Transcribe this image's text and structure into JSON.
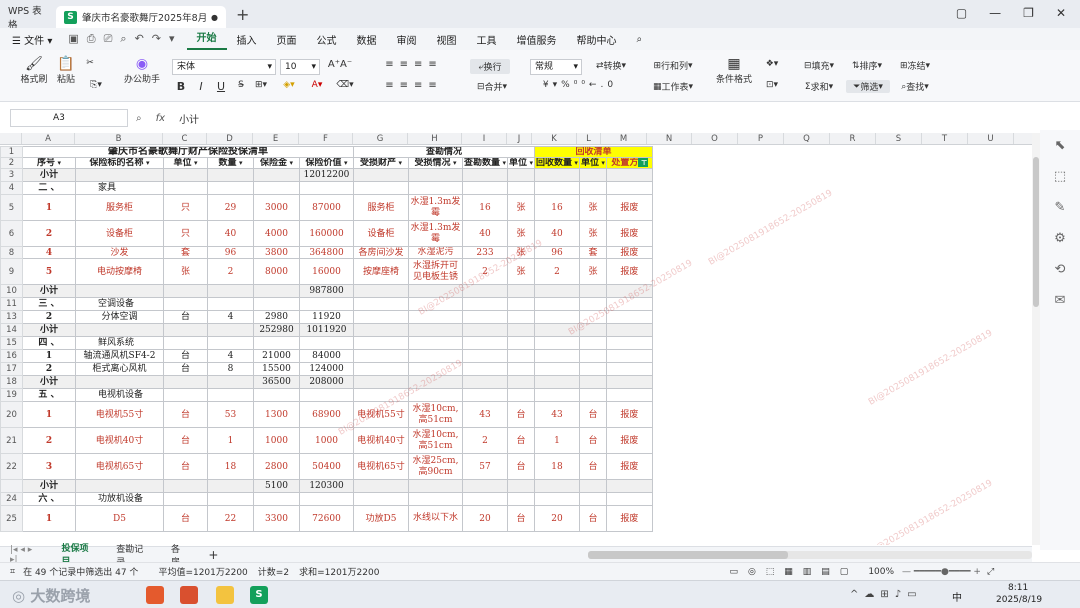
{
  "titlebar": {
    "tab_app": "WPS 表格",
    "tab_doc": "肇庆市名豪歌舞厅2025年8月",
    "doc_badge": "S"
  },
  "menubar": {
    "file": "文件",
    "items": [
      "开始",
      "插入",
      "页面",
      "公式",
      "数据",
      "审阅",
      "视图",
      "工具",
      "增值服务",
      "帮助中心"
    ],
    "active": "开始"
  },
  "ribbon": {
    "format_painter": "格式刷",
    "paste": "粘贴",
    "office_ai": "办公助手",
    "font_name": "宋体",
    "font_size": "10",
    "bold": "B",
    "italic": "I",
    "underline": "U",
    "wrap": "换行",
    "merge": "合并",
    "number_format": "常规",
    "convert": "转换",
    "rows_cols": "行和列",
    "worksheet": "工作表",
    "cond_format": "条件格式",
    "fill": "填充",
    "sort": "排序",
    "freeze": "冻结",
    "sum": "求和",
    "filter": "筛选",
    "find": "查找"
  },
  "formula_bar": {
    "cell_ref": "A3",
    "fx": "fx",
    "content": "小计"
  },
  "columns": [
    "A",
    "B",
    "C",
    "D",
    "E",
    "F",
    "G",
    "H",
    "I",
    "J",
    "K",
    "L",
    "M",
    "N",
    "O",
    "P",
    "Q",
    "R",
    "S",
    "T",
    "U",
    "V"
  ],
  "sheet": {
    "title": "肇庆市名豪歌舞厅财产保险投保清单",
    "check_title": "查勘情况",
    "recovery_title": "回收清单",
    "headers": [
      "序号",
      "保险标的名称",
      "单位",
      "数量",
      "保险金",
      "保险价值",
      "受损财产",
      "受损情况",
      "查勘数量",
      "单位",
      "回收数量",
      "单位",
      "处置方"
    ],
    "rows": [
      {
        "rn": "1",
        "cells": []
      },
      {
        "rn": "2",
        "cells": []
      },
      {
        "rn": "3",
        "cells": [
          "小计",
          "",
          "",
          "",
          "",
          "12012200",
          "",
          "",
          "",
          "",
          "",
          "",
          ""
        ]
      },
      {
        "rn": "4",
        "cells": [
          "二 、",
          "家具",
          "",
          "",
          "",
          "",
          "",
          "",
          "",
          "",
          "",
          "",
          ""
        ]
      },
      {
        "rn": "5",
        "cells": [
          "1",
          "服务柜",
          "只",
          "29",
          "3000",
          "87000",
          "服务柜",
          "水湿1.3m发霉",
          "16",
          "张",
          "16",
          "张",
          "报废"
        ]
      },
      {
        "rn": "6",
        "cells": [
          "2",
          "设备柜",
          "只",
          "40",
          "4000",
          "160000",
          "设备柜",
          "水湿1.3m发霉",
          "40",
          "张",
          "40",
          "张",
          "报废"
        ]
      },
      {
        "rn": "8",
        "cells": [
          "4",
          "沙发",
          "套",
          "96",
          "3800",
          "364800",
          "各房间沙发",
          "水湿泥污",
          "233",
          "张",
          "96",
          "套",
          "报废"
        ]
      },
      {
        "rn": "9",
        "cells": [
          "5",
          "电动按摩椅",
          "张",
          "2",
          "8000",
          "16000",
          "按摩座椅",
          "水湿拆开可见电板生锈",
          "2",
          "张",
          "2",
          "张",
          "报废"
        ]
      },
      {
        "rn": "10",
        "cells": [
          "小计",
          "",
          "",
          "",
          "",
          "987800",
          "",
          "",
          "",
          "",
          "",
          "",
          ""
        ]
      },
      {
        "rn": "11",
        "cells": [
          "三 、",
          "空调设备",
          "",
          "",
          "",
          "",
          "",
          "",
          "",
          "",
          "",
          "",
          ""
        ]
      },
      {
        "rn": "13",
        "cells": [
          "2",
          "分体空调",
          "台",
          "4",
          "2980",
          "11920",
          "",
          "",
          "",
          "",
          "",
          "",
          ""
        ]
      },
      {
        "rn": "14",
        "cells": [
          "小计",
          "",
          "",
          "",
          "252980",
          "1011920",
          "",
          "",
          "",
          "",
          "",
          "",
          ""
        ]
      },
      {
        "rn": "15",
        "cells": [
          "四 、",
          "鲜风系统",
          "",
          "",
          "",
          "",
          "",
          "",
          "",
          "",
          "",
          "",
          ""
        ]
      },
      {
        "rn": "16",
        "cells": [
          "1",
          "轴流通风机SF4-2",
          "台",
          "4",
          "21000",
          "84000",
          "",
          "",
          "",
          "",
          "",
          "",
          ""
        ]
      },
      {
        "rn": "17",
        "cells": [
          "2",
          "柜式离心风机",
          "台",
          "8",
          "15500",
          "124000",
          "",
          "",
          "",
          "",
          "",
          "",
          ""
        ]
      },
      {
        "rn": "18",
        "cells": [
          "小计",
          "",
          "",
          "",
          "36500",
          "208000",
          "",
          "",
          "",
          "",
          "",
          "",
          ""
        ]
      },
      {
        "rn": "19",
        "cells": [
          "五 、",
          "电视机设备",
          "",
          "",
          "",
          "",
          "",
          "",
          "",
          "",
          "",
          "",
          ""
        ]
      },
      {
        "rn": "20",
        "cells": [
          "1",
          "电视机55寸",
          "台",
          "53",
          "1300",
          "68900",
          "电视机55寸",
          "水湿10cm,高51cm",
          "43",
          "台",
          "43",
          "台",
          "报废"
        ]
      },
      {
        "rn": "21",
        "cells": [
          "2",
          "电视机40寸",
          "台",
          "1",
          "1000",
          "1000",
          "电视机40寸",
          "水湿10cm,高51cm",
          "2",
          "台",
          "1",
          "台",
          "报废"
        ]
      },
      {
        "rn": "22",
        "cells": [
          "3",
          "电视机65寸",
          "台",
          "18",
          "2800",
          "50400",
          "电视机65寸",
          "水湿25cm,高90cm",
          "57",
          "台",
          "18",
          "台",
          "报废"
        ]
      },
      {
        "rn": "",
        "cells": [
          "小计",
          "",
          "",
          "",
          "5100",
          "120300",
          "",
          "",
          "",
          "",
          "",
          "",
          ""
        ]
      },
      {
        "rn": "24",
        "cells": [
          "六 、",
          "功放机设备",
          "",
          "",
          "",
          "",
          "",
          "",
          "",
          "",
          "",
          "",
          ""
        ]
      },
      {
        "rn": "25",
        "cells": [
          "1",
          "D5",
          "台",
          "22",
          "3300",
          "72600",
          "功放D5",
          "水线以下水",
          "20",
          "台",
          "20",
          "台",
          "报废"
        ]
      }
    ]
  },
  "sheettabs": {
    "items": [
      "投保项目",
      "查勘记录",
      "各房"
    ],
    "active": "投保项目"
  },
  "statusbar": {
    "filter_info": "在 49 个记录中筛选出 47 个",
    "avg": "平均值=1201万2200",
    "count": "计数=2",
    "sum": "求和=1201万2200",
    "zoom": "100%"
  },
  "taskbar": {
    "brand": "大数跨境",
    "time": "8:11",
    "date": "2025/8/19",
    "lang": "中"
  },
  "watermark": "BI@2025081918652-20250819"
}
